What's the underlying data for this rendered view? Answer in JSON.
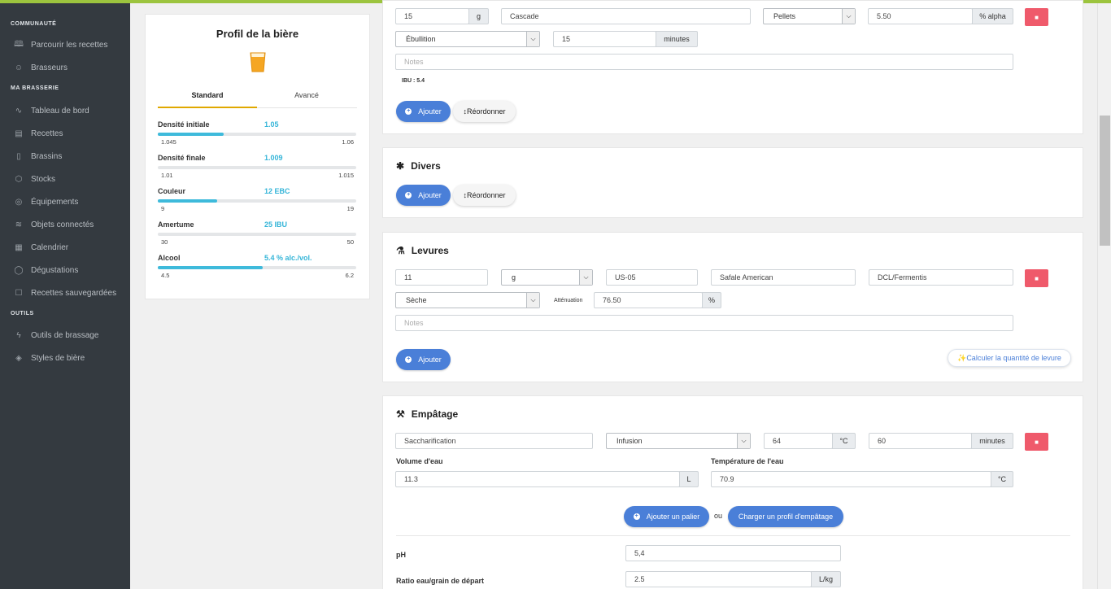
{
  "sidebar": {
    "sections": [
      {
        "title": "COMMUNAUTÉ"
      },
      {
        "title": "MA BRASSERIE"
      },
      {
        "title": "OUTILS"
      }
    ],
    "items": [
      {
        "label": "Parcourir les recettes",
        "icon": "book-icon"
      },
      {
        "label": "Brasseurs",
        "icon": "users-icon"
      },
      {
        "label": "Tableau de bord",
        "icon": "activity-icon"
      },
      {
        "label": "Recettes",
        "icon": "file-icon"
      },
      {
        "label": "Brassins",
        "icon": "clipboard-icon"
      },
      {
        "label": "Stocks",
        "icon": "box-icon"
      },
      {
        "label": "Équipements",
        "icon": "compass-icon"
      },
      {
        "label": "Objets connectés",
        "icon": "wifi-icon"
      },
      {
        "label": "Calendrier",
        "icon": "calendar-icon"
      },
      {
        "label": "Dégustations",
        "icon": "chat-icon"
      },
      {
        "label": "Recettes sauvegardées",
        "icon": "bookmark-icon"
      },
      {
        "label": "Outils de brassage",
        "icon": "bolt-icon"
      },
      {
        "label": "Styles de bière",
        "icon": "layers-icon"
      }
    ]
  },
  "profile": {
    "title": "Profil de la bière",
    "tabs": [
      "Standard",
      "Avancé"
    ],
    "rows": [
      {
        "label": "Densité initiale",
        "value": "1.05",
        "min": "1.045",
        "max": "1.06",
        "fill": 0.33
      },
      {
        "label": "Densité finale",
        "value": "1.009",
        "min": "1.01",
        "max": "1.015",
        "fill": 0
      },
      {
        "label": "Couleur",
        "value": "12 EBC",
        "min": "9",
        "max": "19",
        "fill": 0.3
      },
      {
        "label": "Amertume",
        "value": "25 IBU",
        "min": "30",
        "max": "50",
        "fill": 0
      },
      {
        "label": "Alcool",
        "value": "5.4 % alc./vol.",
        "min": "4.5",
        "max": "6.2",
        "fill": 0.53
      }
    ]
  },
  "hops": {
    "amount": "15",
    "unit": "g",
    "name": "Cascade",
    "form": "Pellets",
    "alpha": "5.50",
    "alpha_unit": "% alpha",
    "use": "Ébullition",
    "time": "15",
    "time_unit": "minutes",
    "notes_placeholder": "Notes",
    "ibu": "IBU : 5.4",
    "add_label": "Ajouter",
    "reorder_label": "Réordonner"
  },
  "misc": {
    "title": "Divers",
    "add_label": "Ajouter",
    "reorder_label": "Réordonner"
  },
  "yeast": {
    "title": "Levures",
    "amount": "11",
    "unit": "g",
    "code": "US-05",
    "name": "Safale American",
    "lab": "DCL/Fermentis",
    "type": "Sèche",
    "attenuation_label": "Atténuation",
    "attenuation": "76.50",
    "attenuation_unit": "%",
    "notes_placeholder": "Notes",
    "add_label": "Ajouter",
    "calc_label": "Calculer la quantité de levure"
  },
  "mash": {
    "title": "Empâtage",
    "step_name": "Saccharification",
    "step_type": "Infusion",
    "temp": "64",
    "temp_unit": "°C",
    "time": "60",
    "time_unit": "minutes",
    "water_volume_label": "Volume d'eau",
    "water_volume": "11.3",
    "water_volume_unit": "L",
    "water_temp_label": "Température de l'eau",
    "water_temp": "70.9",
    "water_temp_unit": "°C",
    "add_step_label": "Ajouter un palier",
    "or_label": "ou",
    "load_profile_label": "Charger un profil d'empâtage",
    "ph_label": "pH",
    "ph": "5,4",
    "ratio_label": "Ratio eau/grain de départ",
    "ratio": "2.5",
    "ratio_unit": "L/kg"
  },
  "colors": {
    "accent": "#4a7fd8",
    "danger": "#ef5a6b",
    "bar": "#3ebadb",
    "topbar": "#9cc43e",
    "sidebar": "#343a40"
  }
}
